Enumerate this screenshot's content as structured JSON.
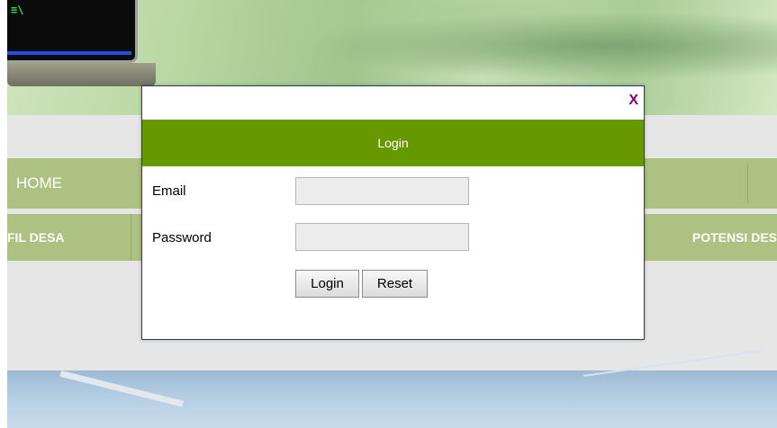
{
  "banner": {
    "monitor_glyph": "≡\\"
  },
  "navigation": {
    "top_menu": [
      {
        "label": "HOME"
      }
    ],
    "sub_menu": [
      {
        "label": "FIL DESA"
      },
      {
        "label": "POTENSI DES"
      }
    ]
  },
  "login_modal": {
    "close_label": "X",
    "title": "Login",
    "email_label": "Email",
    "email_value": "",
    "password_label": "Password",
    "password_value": "",
    "login_button": "Login",
    "reset_button": "Reset",
    "colors": {
      "header_bg": "#669900",
      "close_color": "#800080",
      "border": "#1f3f5f"
    }
  },
  "colors": {
    "menu_bg": "#acc182",
    "page_bg": "#e6e6e6"
  }
}
